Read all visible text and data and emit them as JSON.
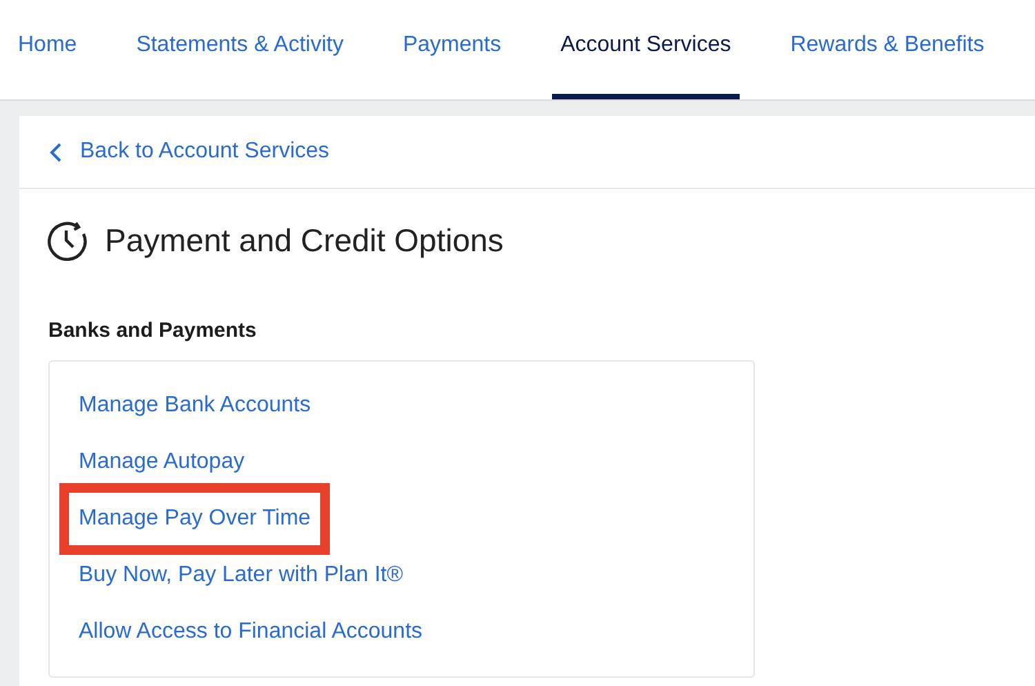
{
  "nav_tabs": [
    {
      "label": "Home",
      "selected": false
    },
    {
      "label": "Statements & Activity",
      "selected": false
    },
    {
      "label": "Payments",
      "selected": false
    },
    {
      "label": "Account Services",
      "selected": true
    },
    {
      "label": "Rewards & Benefits",
      "selected": false
    }
  ],
  "back_link": "Back to Account Services",
  "page_title": "Payment and Credit Options",
  "section": {
    "heading": "Banks and Payments",
    "links": [
      {
        "label": "Manage Bank Accounts",
        "highlighted": false
      },
      {
        "label": "Manage Autopay",
        "highlighted": false
      },
      {
        "label": "Manage Pay Over Time",
        "highlighted": true
      },
      {
        "label": "Buy Now, Pay Later with Plan It®",
        "highlighted": false
      },
      {
        "label": "Allow Access to Financial Accounts",
        "highlighted": false
      }
    ]
  }
}
